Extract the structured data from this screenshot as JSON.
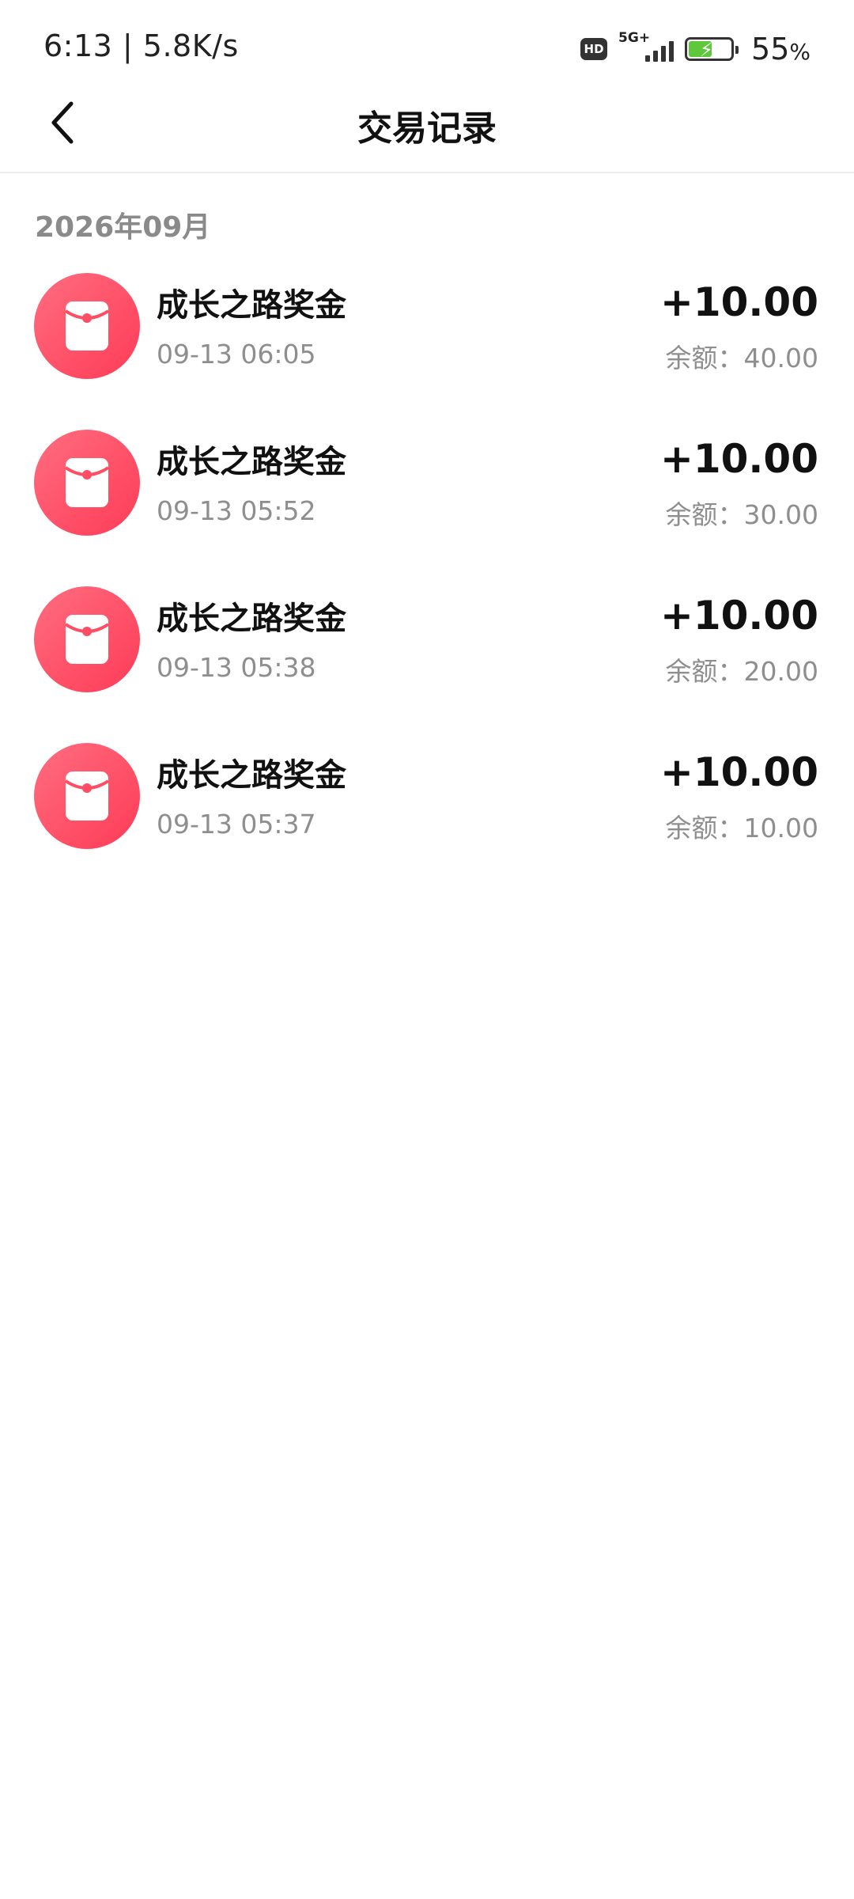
{
  "status_bar": {
    "time_speed": "6:13 | 5.8K/s",
    "hd_label": "HD",
    "network_label": "5G+",
    "battery_percent": "55",
    "battery_unit": "%",
    "battery_level": 0.55
  },
  "nav": {
    "title": "交易记录"
  },
  "month_header": "2026年09月",
  "transactions": [
    {
      "title": "成长之路奖金",
      "time": "09-13 06:05",
      "amount": "+10.00",
      "balance": "余额：40.00"
    },
    {
      "title": "成长之路奖金",
      "time": "09-13 05:52",
      "amount": "+10.00",
      "balance": "余额：30.00"
    },
    {
      "title": "成长之路奖金",
      "time": "09-13 05:38",
      "amount": "+10.00",
      "balance": "余额：20.00"
    },
    {
      "title": "成长之路奖金",
      "time": "09-13 05:37",
      "amount": "+10.00",
      "balance": "余额：10.00"
    }
  ],
  "icons": {
    "back": "chevron-left-icon",
    "transaction": "red-envelope-icon"
  },
  "colors": {
    "accent": "#ff4d63",
    "muted_text": "#8e8e8e"
  }
}
